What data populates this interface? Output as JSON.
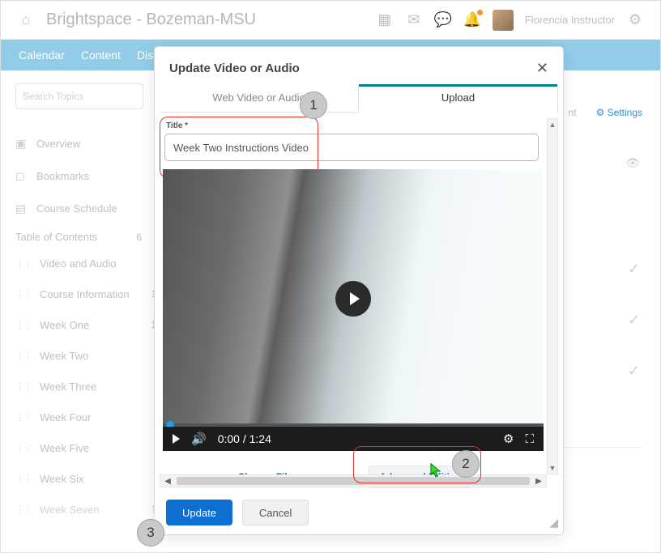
{
  "top": {
    "brand": "Brightspace - Bozeman-MSU",
    "user": "Florencia Instructor"
  },
  "nav": {
    "a": "Calendar",
    "b": "Content",
    "c": "Discu"
  },
  "side": {
    "search_placeholder": "Search Topics",
    "overview": "Overview",
    "bookmarks": "Bookmarks",
    "schedule": "Course Schedule",
    "toc": "Table of Contents",
    "toc_count": "6",
    "items": [
      {
        "label": "Video and Audio",
        "count": ""
      },
      {
        "label": "Course Information",
        "count": "1"
      },
      {
        "label": "Week One",
        "count": "1"
      },
      {
        "label": "Week Two",
        "count": ""
      },
      {
        "label": "Week Three",
        "count": ""
      },
      {
        "label": "Week Four",
        "count": ""
      },
      {
        "label": "Week Five",
        "count": ""
      },
      {
        "label": "Week Six",
        "count": ""
      },
      {
        "label": "Week Seven",
        "count": "1"
      }
    ]
  },
  "mainlinks": {
    "print": "nt",
    "settings": "Settings"
  },
  "modal": {
    "title": "Update Video or Audio",
    "tab_web": "Web Video or Audio",
    "tab_upload": "Upload",
    "title_label": "Title *",
    "title_value": "Week Two Instructions Video",
    "time": "0:00 / 1:24",
    "change": "Change File",
    "advanced": "Advanced Editing",
    "update": "Update",
    "cancel": "Cancel"
  },
  "callouts": {
    "one": "1",
    "two": "2",
    "three": "3"
  }
}
